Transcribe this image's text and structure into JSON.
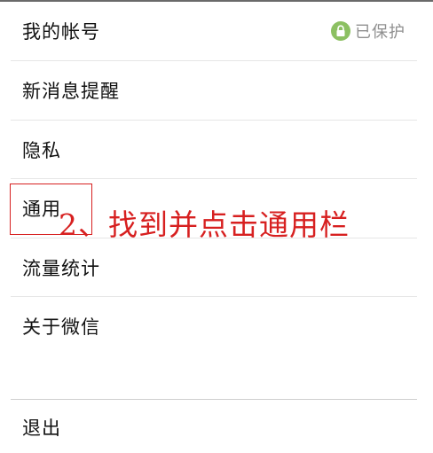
{
  "settings": {
    "items": [
      {
        "label": "我的帐号",
        "status": "已保护"
      },
      {
        "label": "新消息提醒"
      },
      {
        "label": "隐私"
      },
      {
        "label": "通用"
      },
      {
        "label": "流量统计"
      },
      {
        "label": "关于微信"
      }
    ],
    "logout_label": "退出"
  },
  "annotation": {
    "text": "2、找到并点击通用栏",
    "color": "#d72020"
  },
  "icons": {
    "lock": "lock-icon"
  },
  "colors": {
    "protected_badge": "#8cc062",
    "annotation": "#d72020"
  }
}
